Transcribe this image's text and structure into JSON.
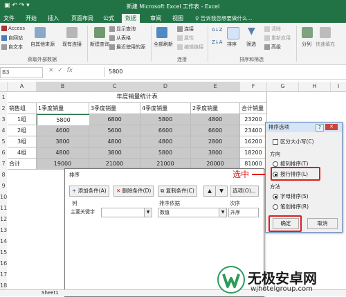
{
  "window": {
    "title": "新建 Microsoft Excel 工作表 - Excel"
  },
  "ribbon_tabs": [
    "文件",
    "开始",
    "插入",
    "页面布局",
    "公式",
    "数据",
    "审阅",
    "视图"
  ],
  "active_tab": "数据",
  "tell_me": "告诉我您想要做什么...",
  "ribbon": {
    "access": "Access",
    "web": "自网站",
    "text": "自文本",
    "other_sources": "自其他来源",
    "existing": "现有连接",
    "get_external_group": "获取外部数据",
    "new_query": "新建查询",
    "show_query": "显示查询",
    "from_table": "从表格",
    "recent_sources": "最近使用的源",
    "refresh_all": "全部刷新",
    "connections": "连接",
    "properties": "属性",
    "edit_links": "编辑链接",
    "conn_group": "连接",
    "sort": "排序",
    "filter": "筛选",
    "clear": "清除",
    "reapply": "重新应用",
    "advanced": "高级",
    "sort_filter_group": "排序和筛选",
    "split": "分列",
    "flash_fill": "快速填充"
  },
  "formula_bar": {
    "name_box": "B3",
    "value": "5800"
  },
  "columns": [
    "A",
    "B",
    "C",
    "D",
    "E",
    "F",
    "G",
    "H",
    "I"
  ],
  "row_numbers": [
    "1",
    "2",
    "3",
    "4",
    "5",
    "6",
    "7",
    "8",
    "9",
    "10",
    "11",
    "12",
    "13",
    "14",
    "15",
    "16",
    "17",
    "18"
  ],
  "table": {
    "title": "年度销量统计表",
    "headers": [
      "销售组",
      "1季度销量",
      "3季度销量",
      "4季度销量",
      "2季度销量",
      "合计销量"
    ],
    "rows": [
      [
        "1组",
        "5800",
        "6800",
        "5800",
        "4800",
        "23200"
      ],
      [
        "2组",
        "4600",
        "5600",
        "6600",
        "6600",
        "23400"
      ],
      [
        "3组",
        "3800",
        "4800",
        "4800",
        "2800",
        "16200"
      ],
      [
        "4组",
        "4800",
        "3800",
        "5800",
        "3800",
        "18200"
      ],
      [
        "合计",
        "19000",
        "21000",
        "21000",
        "20000",
        "81000"
      ]
    ]
  },
  "sort_dialog": {
    "title": "排序",
    "add_level": "添加条件(A)",
    "delete_level": "删除条件(D)",
    "copy_level": "复制条件(C)",
    "options": "选项(O)...",
    "col_header": "列",
    "sort_on_header": "排序依据",
    "order_header": "次序",
    "primary_key": "主要关键字",
    "sort_on_value": "数值",
    "order_value": "升序"
  },
  "annotation": "选中",
  "options_dialog": {
    "title": "排序选项",
    "help": "?",
    "case_sensitive": "区分大小写(C)",
    "direction_label": "方向",
    "by_column": "按列排序(T)",
    "by_row": "按行排序(L)",
    "method_label": "方法",
    "by_letter": "字母排序(S)",
    "by_stroke": "笔划排序(R)",
    "ok": "确定",
    "cancel": "取消"
  },
  "sheet_tab": "Sheet1",
  "watermark": {
    "name": "无极安卓网",
    "url": "wjhotelgroup.com"
  },
  "colors": {
    "excel_green": "#217346",
    "highlight_red": "#e01b1b",
    "cell_gray": "#c9c9c9"
  }
}
